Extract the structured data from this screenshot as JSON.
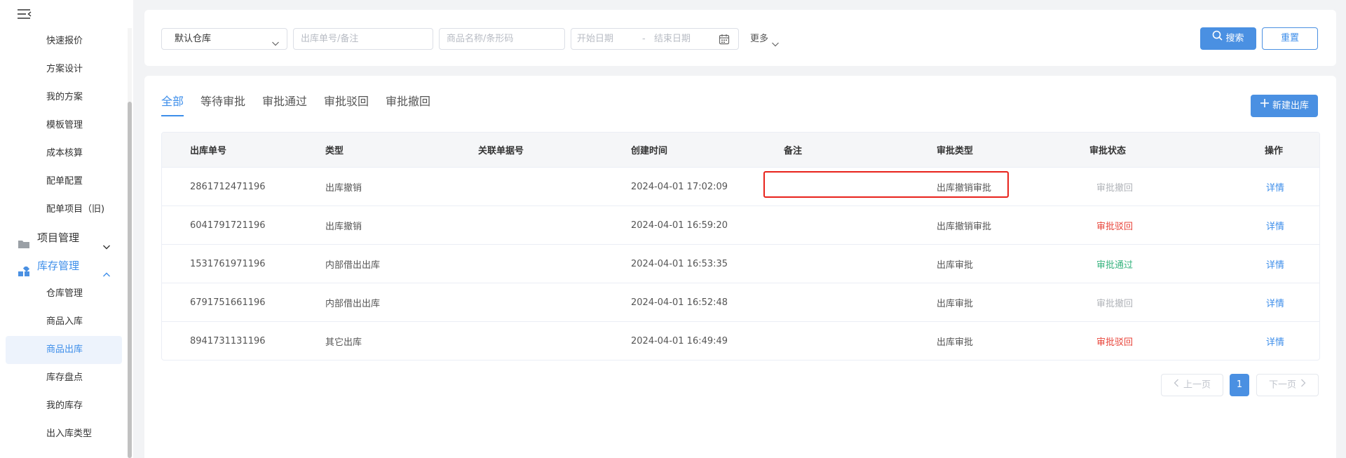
{
  "sidebar": {
    "items_top": [
      {
        "label": "快速报价"
      },
      {
        "label": "方案设计"
      },
      {
        "label": "我的方案"
      },
      {
        "label": "模板管理"
      },
      {
        "label": "成本核算"
      },
      {
        "label": "配单配置"
      },
      {
        "label": "配单项目（旧)"
      }
    ],
    "group_project": {
      "label": "项目管理"
    },
    "group_inventory": {
      "label": "库存管理"
    },
    "items_inventory": [
      {
        "label": "仓库管理"
      },
      {
        "label": "商品入库"
      },
      {
        "label": "商品出库"
      },
      {
        "label": "库存盘点"
      },
      {
        "label": "我的库存"
      },
      {
        "label": "出入库类型"
      }
    ]
  },
  "filters": {
    "warehouse_value": "默认仓库",
    "order_placeholder": "出库单号/备注",
    "product_placeholder": "商品名称/条形码",
    "start_date": "开始日期",
    "date_sep": "-",
    "end_date": "结束日期",
    "more_label": "更多",
    "search_label": "搜索",
    "reset_label": "重置"
  },
  "tabs": [
    {
      "label": "全部"
    },
    {
      "label": "等待审批"
    },
    {
      "label": "审批通过"
    },
    {
      "label": "审批驳回"
    },
    {
      "label": "审批撤回"
    }
  ],
  "new_button_label": "新建出库",
  "table": {
    "headers": [
      "出库单号",
      "类型",
      "关联单据号",
      "创建时间",
      "备注",
      "审批类型",
      "审批状态",
      "操作"
    ],
    "rows": [
      {
        "id": "2861712471196",
        "type": "出库撤销",
        "related": "",
        "created": "2024-04-01 17:02:09",
        "note": "",
        "approval_type": "出库撤销审批",
        "status": "审批撤回",
        "status_color": "#b0b3b8",
        "action": "详情"
      },
      {
        "id": "6041791721196",
        "type": "出库撤销",
        "related": "",
        "created": "2024-04-01 16:59:20",
        "note": "",
        "approval_type": "出库撤销审批",
        "status": "审批驳回",
        "status_color": "#e8443a",
        "action": "详情"
      },
      {
        "id": "1531761971196",
        "type": "内部借出出库",
        "related": "",
        "created": "2024-04-01 16:53:35",
        "note": "",
        "approval_type": "出库审批",
        "status": "审批通过",
        "status_color": "#36b37e",
        "action": "详情"
      },
      {
        "id": "6791751661196",
        "type": "内部借出出库",
        "related": "",
        "created": "2024-04-01 16:52:48",
        "note": "",
        "approval_type": "出库审批",
        "status": "审批撤回",
        "status_color": "#b0b3b8",
        "action": "详情"
      },
      {
        "id": "8941731131196",
        "type": "其它出库",
        "related": "",
        "created": "2024-04-01 16:49:49",
        "note": "",
        "approval_type": "出库审批",
        "status": "审批驳回",
        "status_color": "#e8443a",
        "action": "详情"
      }
    ]
  },
  "pagination": {
    "prev_label": "上一页",
    "current_page": "1",
    "next_label": "下一页"
  },
  "colors": {
    "accent": "#4a90e2",
    "highlight_box": "#e8221b"
  }
}
